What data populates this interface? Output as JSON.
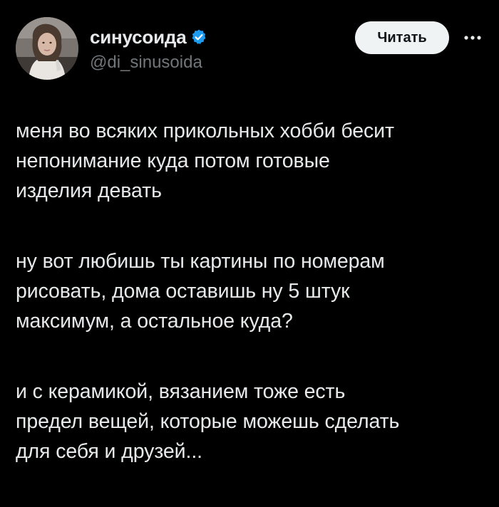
{
  "author": {
    "display_name": "синусоида",
    "handle": "@di_sinusoida",
    "avatar_icon": "profile-photo",
    "verified_icon": "verified-badge-icon",
    "verified_color": "#1d9bf0"
  },
  "actions": {
    "follow_label": "Читать",
    "more_icon": "more-dots-icon"
  },
  "tweet": {
    "paragraphs": [
      {
        "lines": [
          "меня во всяких прикольных хобби бесит",
          "непонимание куда потом готовые",
          "изделия девать"
        ]
      },
      {
        "lines": [
          "ну вот любишь ты картины по номерам",
          "рисовать, дома оставишь ну 5 штук",
          "максимум, а остальное куда?"
        ]
      },
      {
        "lines": [
          "и с керамикой, вязанием тоже есть",
          "предел вещей, которые можешь сделать",
          "для себя и друзей..."
        ]
      }
    ]
  },
  "colors": {
    "background": "#000000",
    "text_primary": "#e7e9ea",
    "text_secondary": "#71767b",
    "button_bg": "#eff3f4",
    "button_text": "#0f1419"
  }
}
